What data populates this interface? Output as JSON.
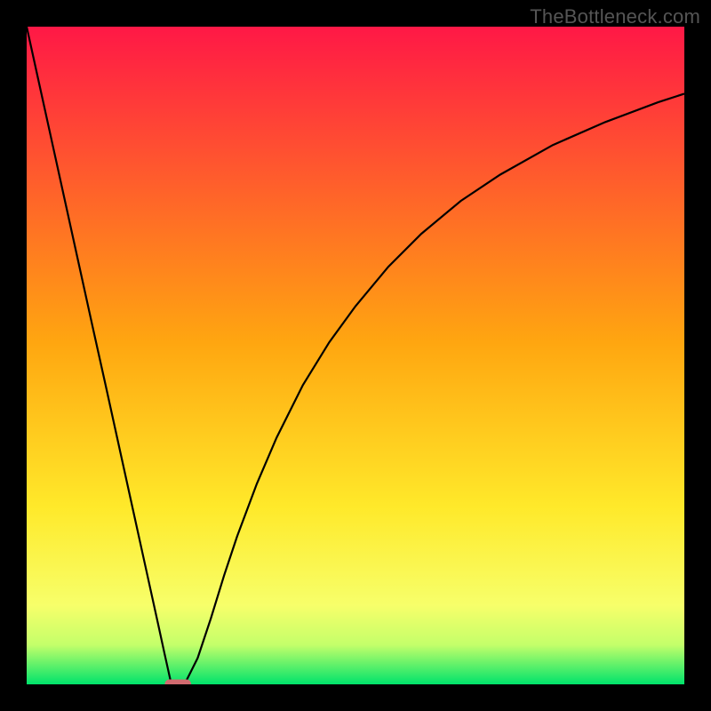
{
  "watermark": "TheBottleneck.com",
  "chart_data": {
    "type": "line",
    "title": "",
    "xlabel": "",
    "ylabel": "",
    "xlim": [
      0,
      100
    ],
    "ylim": [
      0,
      100
    ],
    "grid": false,
    "legend": false,
    "background_gradient": {
      "top_color": "#ff1846",
      "mid_color": "#ffd011",
      "bottom_color": "#00e36b",
      "direction": "vertical"
    },
    "x": [
      0,
      2,
      4,
      6,
      8,
      10,
      12,
      14,
      16,
      18,
      20,
      21,
      22,
      23,
      24,
      25,
      26,
      28,
      30,
      32,
      35,
      38,
      42,
      46,
      50,
      55,
      60,
      66,
      72,
      80,
      88,
      96,
      100
    ],
    "values": [
      100,
      90.9,
      81.8,
      72.7,
      63.6,
      54.5,
      45.5,
      36.4,
      27.3,
      18.2,
      9.1,
      4.5,
      0,
      0,
      0,
      2.0,
      4.0,
      10.0,
      16.5,
      22.5,
      30.5,
      37.5,
      45.5,
      52.0,
      57.5,
      63.5,
      68.5,
      73.5,
      77.5,
      82.0,
      85.5,
      88.5,
      89.8
    ],
    "marker": {
      "shape": "pill",
      "x_center": 23,
      "y": 0,
      "width_x_units": 4,
      "color": "#d16a6f"
    }
  }
}
